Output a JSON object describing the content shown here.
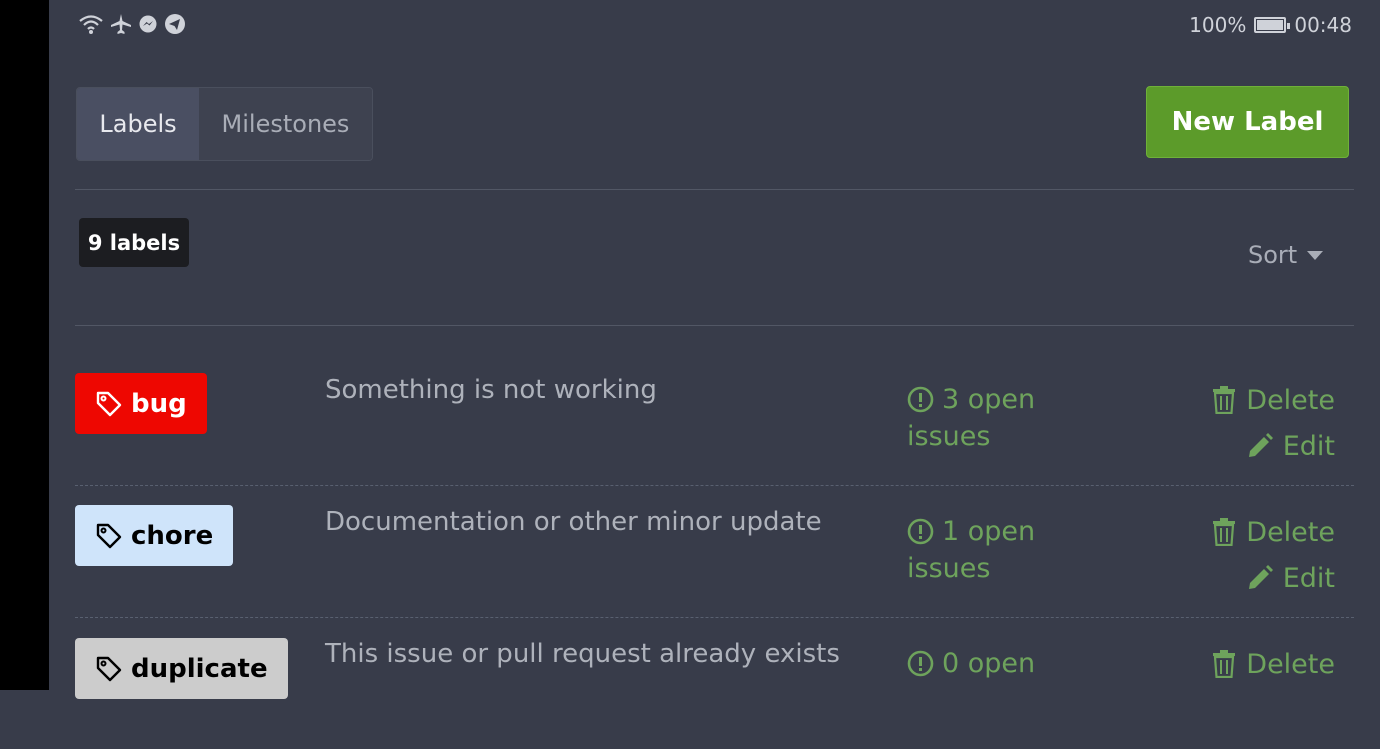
{
  "status_bar": {
    "battery_percent": "100%",
    "time": "00:48",
    "battery_level": 1.0,
    "icons": [
      "wifi-icon",
      "airplane-icon",
      "messenger-icon",
      "telegram-icon"
    ]
  },
  "tabs": [
    {
      "label": "Labels",
      "active": true
    },
    {
      "label": "Milestones",
      "active": false
    }
  ],
  "new_label_button": "New Label",
  "label_count": "9 labels",
  "sort_label": "Sort",
  "labels": [
    {
      "name": "bug",
      "description": "Something is not working",
      "issues_line1": "3 open",
      "issues_line2": "issues",
      "bg": "#ee0701",
      "fg": "#ffffff",
      "delete": "Delete",
      "edit": "Edit"
    },
    {
      "name": "chore",
      "description": "Documentation or other minor update",
      "issues_line1": "1 open",
      "issues_line2": "issues",
      "bg": "#cfe4fa",
      "fg": "#000000",
      "delete": "Delete",
      "edit": "Edit"
    },
    {
      "name": "duplicate",
      "description": "This issue or pull request already exists",
      "issues_line1": "0 open",
      "issues_line2": "",
      "bg": "#cccccc",
      "fg": "#000000",
      "delete": "Delete",
      "edit": ""
    }
  ],
  "colors": {
    "background": "#383c4a",
    "accent_green": "#5c9b2a",
    "link_green": "#6ea35c"
  }
}
